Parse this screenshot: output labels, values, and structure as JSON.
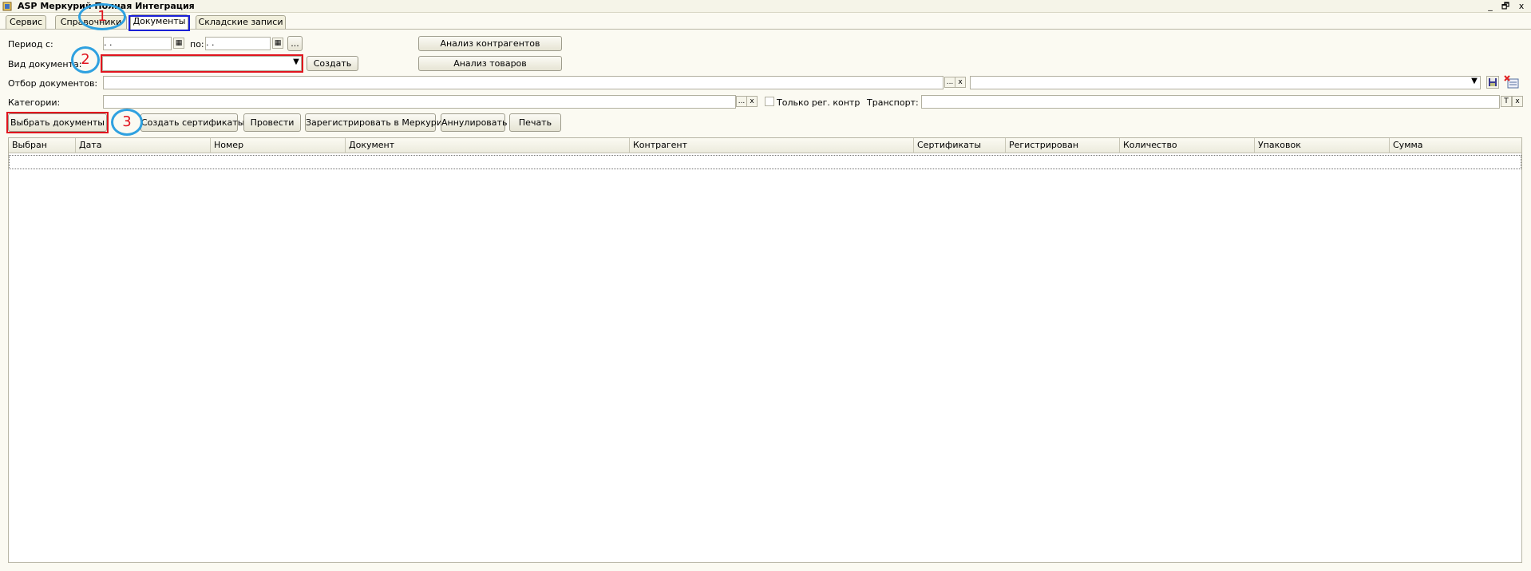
{
  "window": {
    "title": "ASP Меркурий Полная Интеграция",
    "controls": {
      "minimize": "_",
      "restore": "🗗",
      "close": "x"
    }
  },
  "tabs": [
    {
      "label": "Сервис"
    },
    {
      "label": "Справочники"
    },
    {
      "label": "Документы"
    },
    {
      "label": "Складские записи"
    }
  ],
  "filters": {
    "period_from_label": "Период с:",
    "period_from_value": " .  .",
    "period_to_label": "по:",
    "period_to_value": " .  .",
    "period_more": "...",
    "doc_type_label": "Вид документа:",
    "doc_type_value": "",
    "create_label": "Создать",
    "selection_label": "Отбор документов:",
    "categories_label": "Категории:",
    "only_reg_label": "Только рег. контр",
    "transport_label": "Транспорт:",
    "analysis_contractors": "Анализ контрагентов",
    "analysis_goods": "Анализ товаров",
    "ellipsis": "...",
    "clear": "x",
    "text_mode": "T"
  },
  "toolbar": {
    "select_docs": "Выбрать документы",
    "create_certs": "Создать сертификаты",
    "post": "Провести",
    "register_mercury": "Зарегистрировать в Меркурии",
    "cancel": "Аннулировать",
    "print": "Печать"
  },
  "table": {
    "columns": [
      "Выбран",
      "Дата",
      "Номер",
      "Документ",
      "Контрагент",
      "Сертификаты",
      "Регистрирован",
      "Количество",
      "Упаковок",
      "Сумма"
    ],
    "rows": []
  },
  "annotations": [
    "1",
    "2",
    "3"
  ],
  "colors": {
    "highlight_red": "#e0141e",
    "highlight_blue": "#1a20d6",
    "annotation_ring": "#2fa1e0"
  }
}
